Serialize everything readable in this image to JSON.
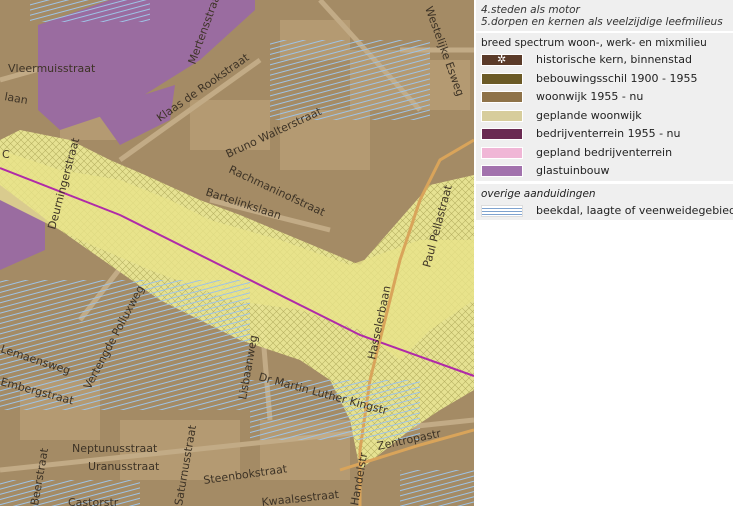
{
  "legend": {
    "header_line1": "4.steden als motor",
    "header_line2": "5.dorpen en kernen als veelzijdige leefmilieus",
    "section_title": "breed spectrum woon-, werk- en mixmilieu",
    "items": [
      {
        "label": "historische kern, binnenstad",
        "color": "#5a3a28",
        "icon": "star-icon"
      },
      {
        "label": "bebouwingsschil 1900 - 1955",
        "color": "#6b5a26"
      },
      {
        "label": "woonwijk 1955 - nu",
        "color": "#8e7248"
      },
      {
        "label": "geplande woonwijk",
        "color": "#d7cd9c"
      },
      {
        "label": "bedrijventerrein 1955 - nu",
        "color": "#6a2a52"
      },
      {
        "label": "gepland bedrijventerrein",
        "color": "#f0b6d6"
      },
      {
        "label": "glastuinbouw",
        "color": "#a272ad"
      }
    ],
    "other_title": "overige aanduidingen",
    "other_items": [
      {
        "label": "beekdal, laagte of veenweidegebied",
        "color": "#7fa3cf",
        "pattern": "stripes"
      }
    ]
  },
  "map": {
    "street_labels": [
      "Vleermuisstraat",
      "Klaas de Rookstraat",
      "Mertensstraat",
      "Westelijke Esweg",
      "Bruno Walterstraat",
      "Rachmaninofstraat",
      "Bartelinkslaan",
      "Deurningerstraat",
      "Vertengde Polluxweg",
      "Lisbaanweg",
      "Dr Martin Luther Kingstr",
      "Hasselerbaan",
      "Paul Pellastraat",
      "Neptunusstraat",
      "Uranusstraat",
      "Steenbokstraat",
      "Saturnusstraat",
      "Handelstr",
      "Castorstr",
      "Beerstraat",
      "Lemaensweg",
      "Embergstraat",
      "Zentropastr",
      "Kwaalsestraat",
      "laan",
      "C"
    ]
  }
}
